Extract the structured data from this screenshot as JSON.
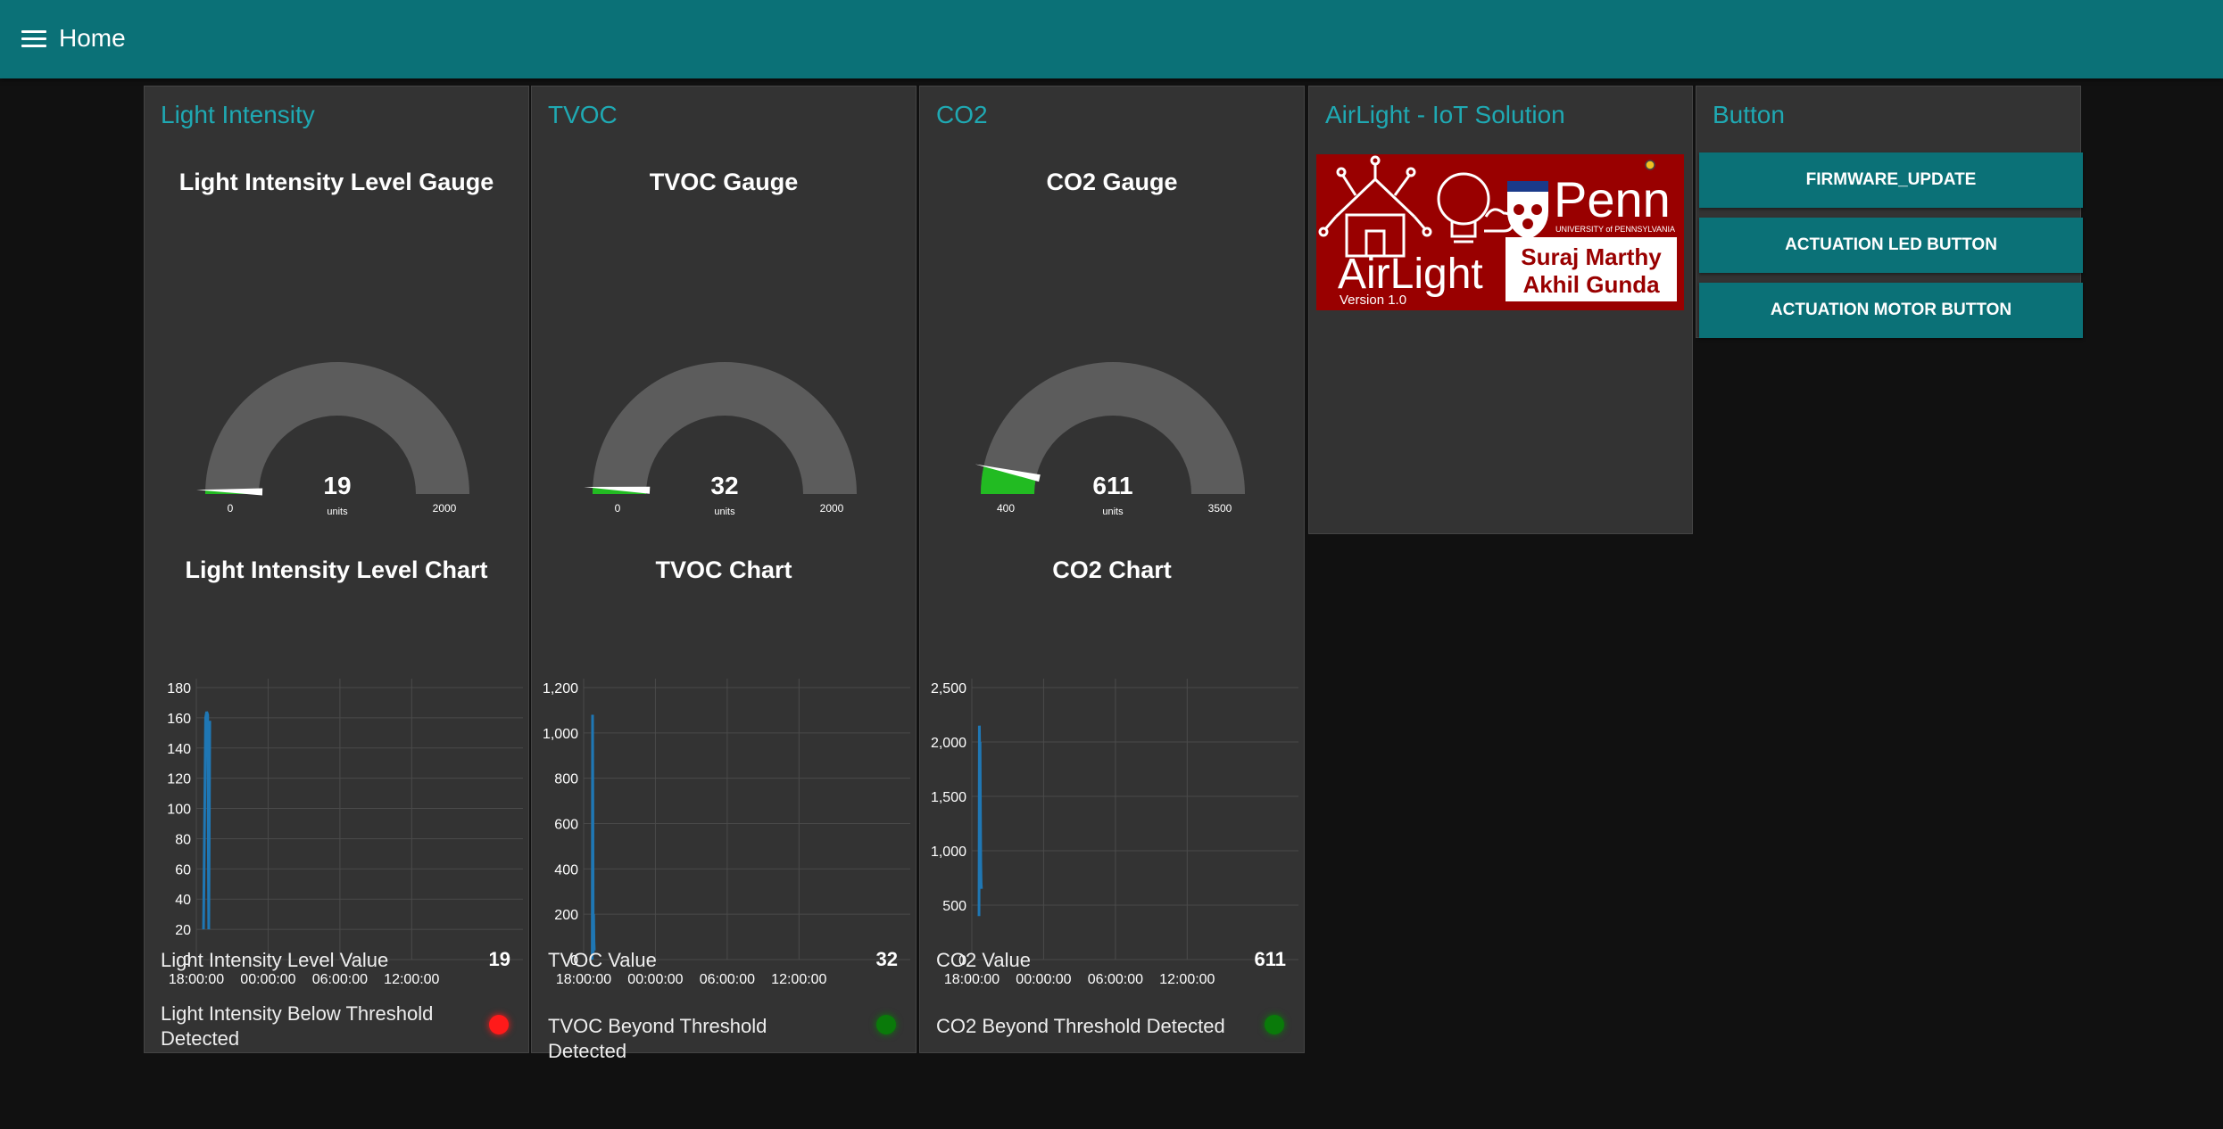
{
  "header": {
    "title": "Home"
  },
  "panels": [
    {
      "title": "Light Intensity",
      "gauge": {
        "title": "Light Intensity Level Gauge",
        "value": "19",
        "units": "units",
        "min": 0,
        "max": 2000,
        "min_label": "0",
        "max_label": "2000"
      },
      "chart": {
        "title": "Light Intensity Level Chart"
      },
      "value_row": {
        "label": "Light Intensity Level Value",
        "value": "19"
      },
      "threshold_row": {
        "label": "Light Intensity Below Threshold Detected",
        "led_color": "#ff1a1a"
      }
    },
    {
      "title": "TVOC",
      "gauge": {
        "title": "TVOC Gauge",
        "value": "32",
        "units": "units",
        "min": 0,
        "max": 2000,
        "min_label": "0",
        "max_label": "2000"
      },
      "chart": {
        "title": "TVOC Chart"
      },
      "value_row": {
        "label": "TVOC Value",
        "value": "32"
      },
      "threshold_row": {
        "label": "TVOC Beyond Threshold Detected",
        "led_color": "#0a7a0a"
      }
    },
    {
      "title": "CO2",
      "gauge": {
        "title": "CO2 Gauge",
        "value": "611",
        "units": "units",
        "min": 400,
        "max": 3500,
        "min_label": "400",
        "max_label": "3500"
      },
      "chart": {
        "title": "CO2 Chart"
      },
      "value_row": {
        "label": "CO2 Value",
        "value": "611"
      },
      "threshold_row": {
        "label": "CO2 Beyond Threshold Detected",
        "led_color": "#0a7a0a"
      }
    }
  ],
  "airlight": {
    "title": "AirLight - IoT Solution",
    "logo": {
      "name": "AirLight",
      "version": "Version 1.0",
      "university": "Penn",
      "university_sub": "UNIVERSITY of PENNSYLVANIA",
      "authors": [
        "Suraj Marthy",
        "Akhil Gunda"
      ]
    }
  },
  "button_panel": {
    "title": "Button",
    "buttons": [
      "FIRMWARE_UPDATE",
      "ACTUATION LED BUTTON",
      "ACTUATION MOTOR BUTTON"
    ]
  },
  "colors": {
    "accent": "#1fa9b3",
    "header": "#0b7177",
    "gauge_fill": "#22bb22",
    "gauge_track": "#5c5c5c",
    "line": "#1f77b4"
  },
  "chart_data": [
    {
      "type": "line",
      "title": "Light Intensity Level Chart",
      "x_ticks": [
        "18:00:00",
        "00:00:00",
        "06:00:00",
        "12:00:00"
      ],
      "y_ticks": [
        "0",
        "20",
        "40",
        "60",
        "80",
        "100",
        "120",
        "140",
        "160",
        "180"
      ],
      "ylim": [
        0,
        180
      ],
      "series": [
        {
          "x": [
            "18:00:00",
            "18:30:00",
            "18:45:00",
            "19:00:00",
            "19:15:00",
            "19:30:00"
          ],
          "values": [
            20,
            160,
            164,
            162,
            20,
            158
          ]
        }
      ]
    },
    {
      "type": "line",
      "title": "TVOC Chart",
      "x_ticks": [
        "18:00:00",
        "00:00:00",
        "06:00:00",
        "12:00:00"
      ],
      "y_ticks": [
        "0",
        "200",
        "400",
        "600",
        "800",
        "1,000",
        "1,200"
      ],
      "ylim": [
        0,
        1200
      ],
      "series": [
        {
          "x": [
            "18:20:00",
            "18:25:00",
            "18:30:00",
            "18:35:00",
            "18:40:00",
            "18:45:00",
            "18:50:00"
          ],
          "values": [
            0,
            1080,
            650,
            30,
            200,
            80,
            40
          ]
        }
      ]
    },
    {
      "type": "line",
      "title": "CO2 Chart",
      "x_ticks": [
        "18:00:00",
        "00:00:00",
        "06:00:00",
        "12:00:00"
      ],
      "y_ticks": [
        "0",
        "500",
        "1,000",
        "1,500",
        "2,000",
        "2,500"
      ],
      "ylim": [
        0,
        2500
      ],
      "series": [
        {
          "x": [
            "18:00:00",
            "18:05:00",
            "18:10:00",
            "18:15:00",
            "18:20:00",
            "18:25:00",
            "18:30:00",
            "18:35:00"
          ],
          "values": [
            400,
            2150,
            1900,
            2000,
            1400,
            900,
            700,
            650
          ]
        }
      ]
    }
  ]
}
